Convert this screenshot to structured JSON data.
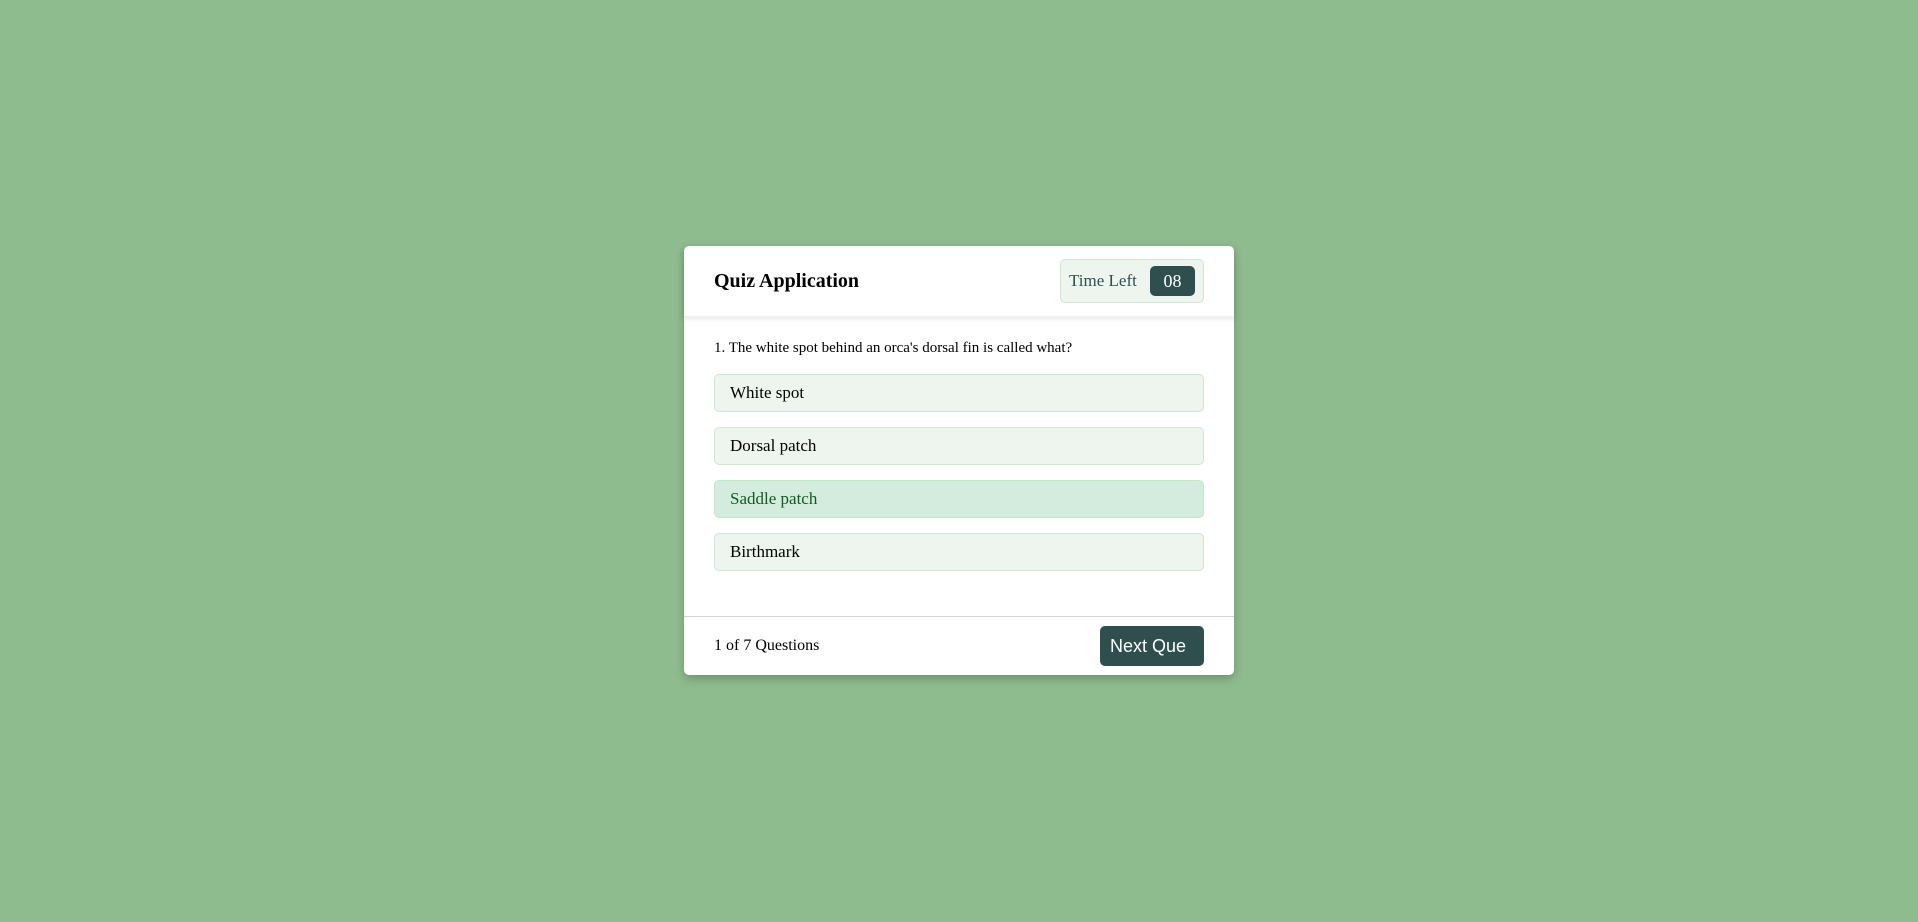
{
  "header": {
    "title": "Quiz Application",
    "timer_label": "Time Left",
    "timer_seconds": "08"
  },
  "question": {
    "text": "1. The white spot behind an orca's dorsal fin is called what?",
    "options": [
      {
        "label": "White spot",
        "state": "default"
      },
      {
        "label": "Dorsal patch",
        "state": "default"
      },
      {
        "label": "Saddle patch",
        "state": "correct"
      },
      {
        "label": "Birthmark",
        "state": "default"
      }
    ]
  },
  "footer": {
    "current": "1",
    "of_text": "of",
    "total": "7",
    "questions_text": "Questions",
    "next_label": "Next Que"
  },
  "colors": {
    "background": "#8fbc8f",
    "accent": "#2f4f4f",
    "option_bg": "#edf5ee",
    "correct_bg": "#d4ecdd",
    "correct_text": "#155724"
  }
}
